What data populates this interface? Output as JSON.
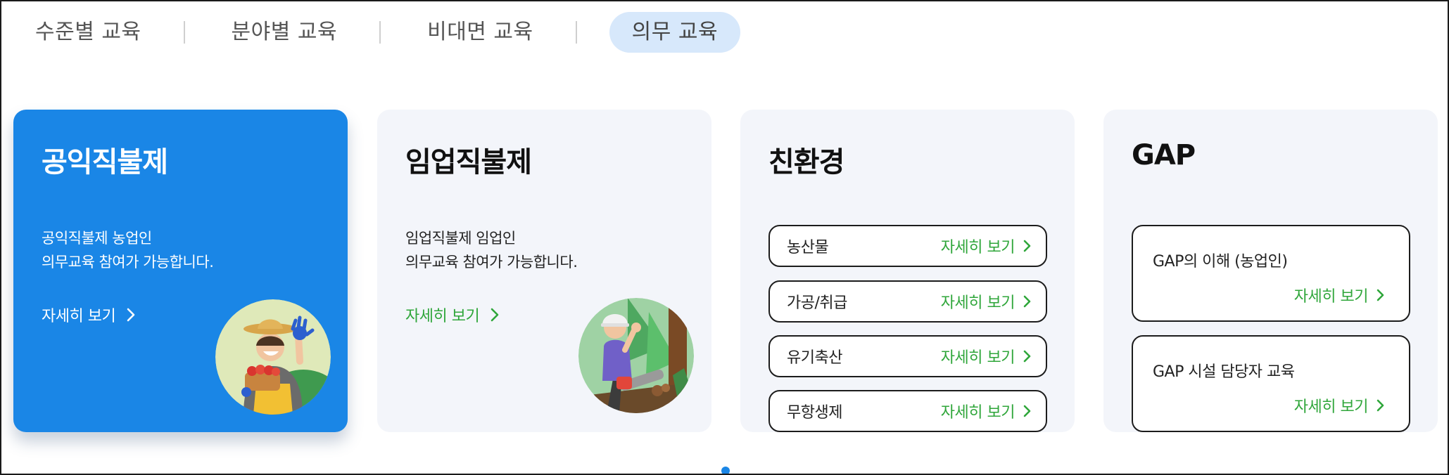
{
  "tabs": [
    {
      "label": "수준별 교육",
      "active": false
    },
    {
      "label": "분야별 교육",
      "active": false
    },
    {
      "label": "비대면 교육",
      "active": false
    },
    {
      "label": "의무 교육",
      "active": true
    }
  ],
  "cards": {
    "public": {
      "title": "공익직불제",
      "desc_line1": "공익직불제 농업인",
      "desc_line2": "의무교육 참여가 가능합니다.",
      "link": "자세히 보기"
    },
    "forestry": {
      "title": "임업직불제",
      "desc_line1": "임업직불제 임업인",
      "desc_line2": "의무교육 참여가 가능합니다.",
      "link": "자세히 보기"
    },
    "eco": {
      "title": "친환경",
      "items": [
        {
          "label": "농산물",
          "more": "자세히 보기"
        },
        {
          "label": "가공/취급",
          "more": "자세히 보기"
        },
        {
          "label": "유기축산",
          "more": "자세히 보기"
        },
        {
          "label": "무항생제",
          "more": "자세히 보기"
        }
      ]
    },
    "gap": {
      "title": "GAP",
      "items": [
        {
          "label": "GAP의 이해 (농업인)",
          "more": "자세히 보기"
        },
        {
          "label": "GAP 시설 담당자 교육",
          "more": "자세히 보기"
        }
      ]
    }
  },
  "colors": {
    "primary": "#1a86e6",
    "accent_green": "#2fa63a",
    "active_tab_bg": "#d7e8fb",
    "card_bg": "#f3f5fa"
  },
  "icons": {
    "link_arrow": "chevron-right-icon",
    "farmer_illustration": "farmer-illustration",
    "forester_illustration": "forester-illustration"
  },
  "pagination": {
    "current": 1
  }
}
